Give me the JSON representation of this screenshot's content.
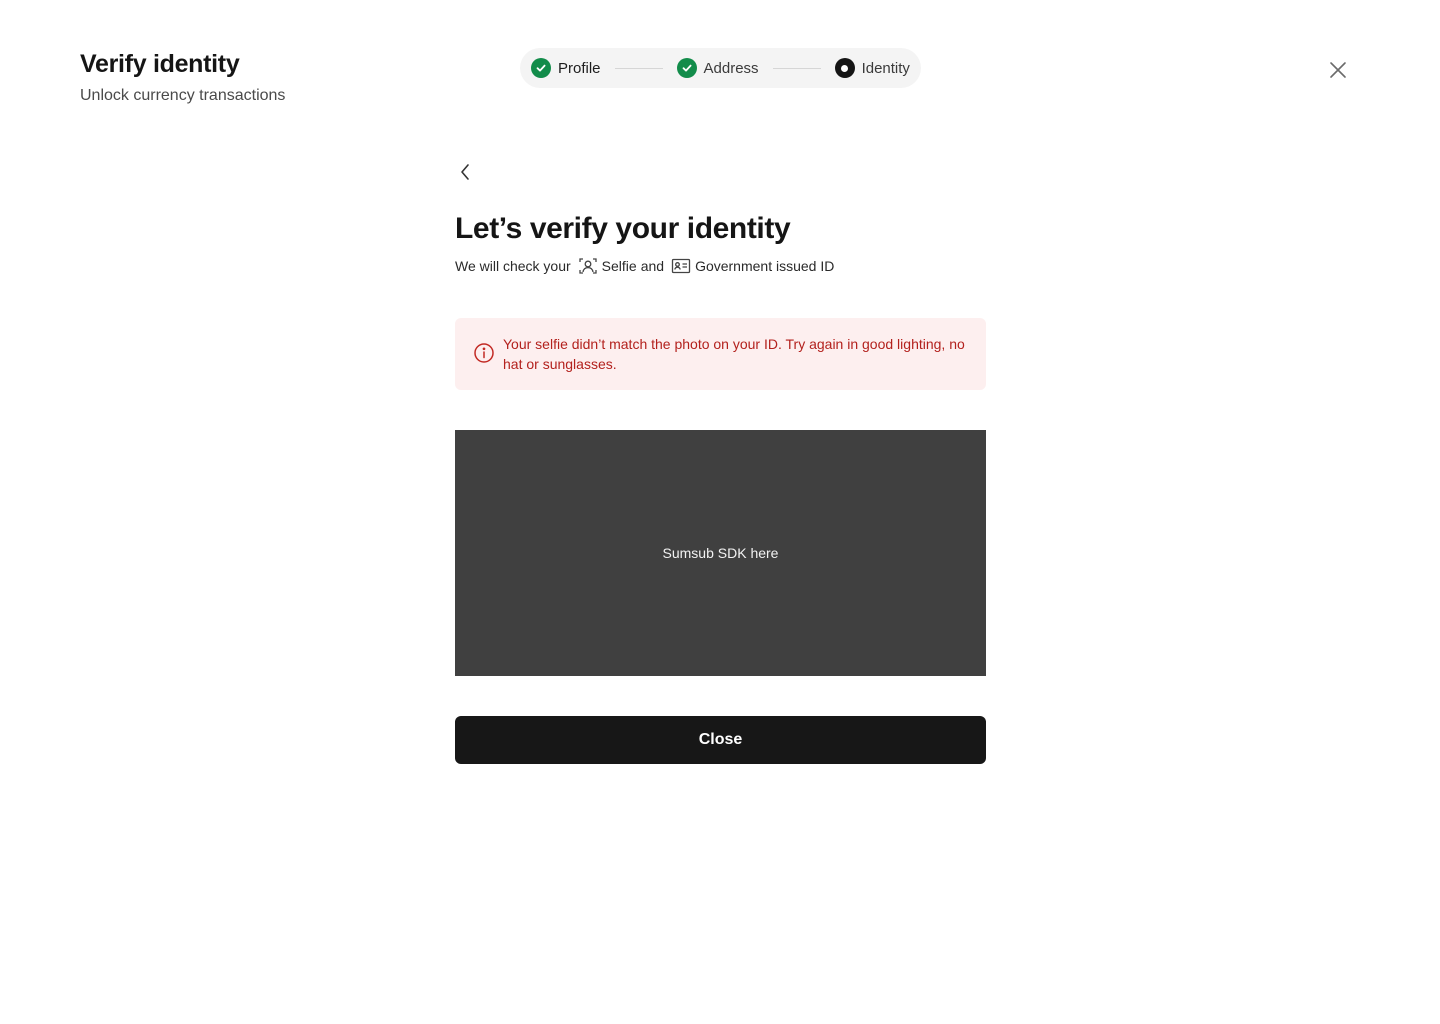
{
  "header": {
    "title": "Verify identity",
    "subtitle": "Unlock currency transactions"
  },
  "stepper": {
    "steps": [
      {
        "label": "Profile",
        "status": "done"
      },
      {
        "label": "Address",
        "status": "done"
      },
      {
        "label": "Identity",
        "status": "current"
      }
    ]
  },
  "icons": {
    "close": "close-icon",
    "back": "chevron-left-icon",
    "selfie": "face-scan-icon",
    "id_card": "id-card-icon",
    "error": "info-circle-icon",
    "step_done": "check-icon"
  },
  "main": {
    "title": "Let’s verify your identity",
    "check_prefix": "We will check your",
    "selfie_label": "Selfie",
    "and_label": "and",
    "id_label": "Government issued ID",
    "error_message": "Your selfie didn’t match the photo on your ID. Try again in good lighting, no hat or sunglasses.",
    "sdk_placeholder": "Sumsub SDK here",
    "close_button": "Close"
  },
  "colors": {
    "success": "#128c4a",
    "error_text": "#b3211d",
    "error_bg": "#fdefef",
    "primary_button": "#171717",
    "sdk_bg": "#404040"
  }
}
